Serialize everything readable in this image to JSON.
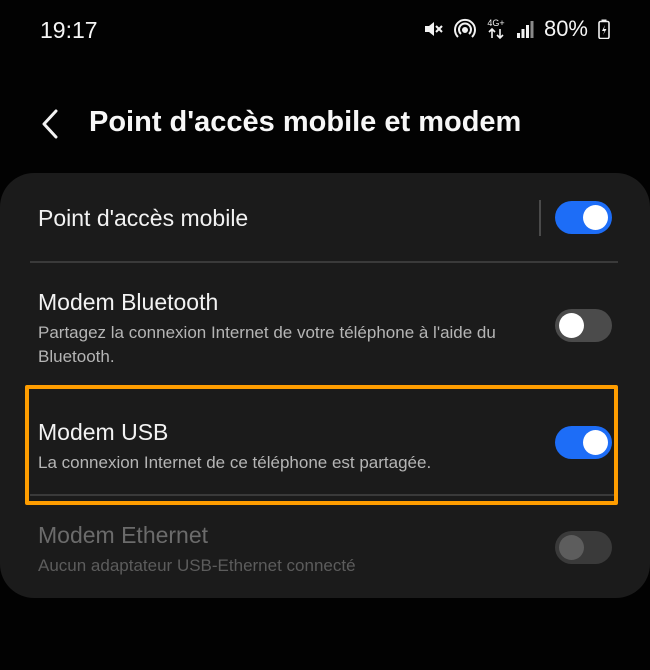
{
  "status_bar": {
    "time": "19:17",
    "network": "4G+",
    "battery": "80%",
    "icons": [
      "mute-icon",
      "hotspot-icon",
      "network-4g-icon",
      "signal-icon",
      "battery-charging-icon"
    ]
  },
  "header": {
    "back_icon": "chevron-left-icon",
    "title": "Point d'accès mobile et modem"
  },
  "settings": {
    "hotspot": {
      "title": "Point d'accès mobile",
      "enabled": true
    },
    "bluetooth": {
      "title": "Modem Bluetooth",
      "subtitle": "Partagez la connexion Internet de votre téléphone à l'aide du Bluetooth.",
      "enabled": false
    },
    "usb": {
      "title": "Modem USB",
      "subtitle": "La connexion Internet de ce téléphone est partagée.",
      "enabled": true,
      "highlighted": true
    },
    "ethernet": {
      "title": "Modem Ethernet",
      "subtitle": "Aucun adaptateur USB-Ethernet connecté",
      "enabled": false,
      "disabled": true
    }
  },
  "colors": {
    "accent": "#1d6df7",
    "highlight": "#ff9d00",
    "card": "#1b1b1b",
    "background": "#020202"
  }
}
